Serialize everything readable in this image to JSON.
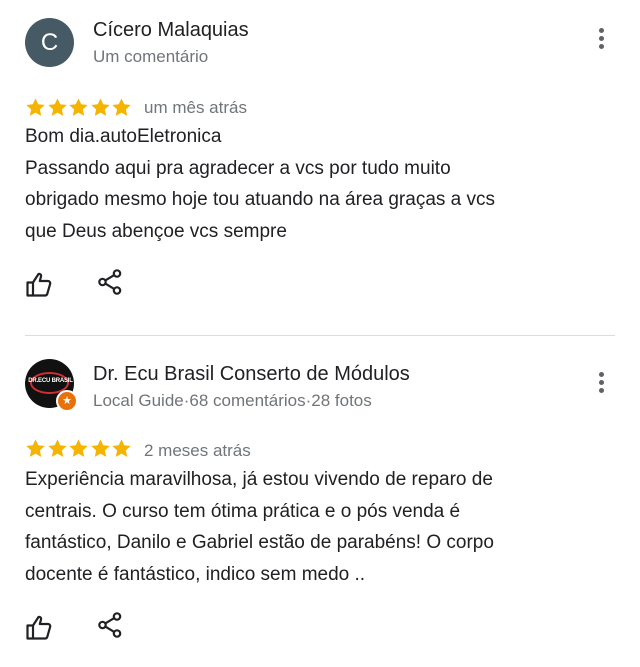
{
  "reviews": [
    {
      "avatar_letter": "C",
      "author": "Cícero Malaquias",
      "meta": "Um comentário",
      "rating": 5,
      "time": "um mês atrás",
      "text_lines": [
        "Bom dia.autoEletronica",
        "Passando aqui pra agradecer a vcs por tudo muito",
        "obrigado mesmo hoje tou atuando na área graças a vcs",
        "que Deus abençoe vcs sempre"
      ],
      "icons": {
        "more": "more-vert-icon",
        "like": "thumb-up-icon",
        "share": "share-icon"
      }
    },
    {
      "avatar_text": "DR.ECU BRASIL",
      "author": "Dr. Ecu Brasil Conserto de Módulos",
      "meta": "Local Guide·68 comentários·28 fotos",
      "rating": 5,
      "time": "2 meses atrás",
      "text_lines": [
        "Experiência maravilhosa, já estou vivendo de reparo de",
        "centrais. O curso tem ótima prática e o pós venda é",
        "fantástico, Danilo e Gabriel estão de parabéns! O corpo",
        "docente é fantástico, indico sem medo .."
      ],
      "icons": {
        "more": "more-vert-icon",
        "like": "thumb-up-icon",
        "share": "share-icon",
        "badge": "local-guide-star-icon"
      }
    }
  ],
  "colors": {
    "star": "#f4b400",
    "avatar_c": "#455a64",
    "meta_text": "#70757a",
    "divider": "#dadce0",
    "guide_badge": "#e8710a"
  }
}
